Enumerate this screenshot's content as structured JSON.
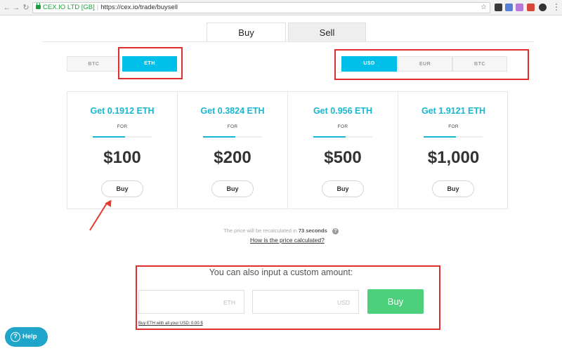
{
  "browser": {
    "secure_label": "CEX.IO LTD [GB]",
    "url": "https://cex.io/trade/buysell"
  },
  "icons": {
    "back": "arrow-left-icon",
    "forward": "arrow-right-icon",
    "reload": "reload-icon",
    "lock": "lock-icon",
    "bookmark": "star-icon",
    "menu": "more-vert-icon",
    "help": "question-circle-icon",
    "info": "question-circle-icon"
  },
  "browser_glyphs": {
    "back": "←",
    "forward": "→",
    "reload": "↻",
    "star": "☆",
    "menu": "⋮"
  },
  "tabs": [
    {
      "label": "Buy",
      "active": true
    },
    {
      "label": "Sell",
      "active": false
    }
  ],
  "crypto_toggle": [
    {
      "label": "BTC",
      "active": false
    },
    {
      "label": "ETH",
      "active": true
    }
  ],
  "currency_toggle": [
    {
      "label": "USD",
      "active": true
    },
    {
      "label": "EUR",
      "active": false
    },
    {
      "label": "BTC",
      "active": false
    }
  ],
  "cards": [
    {
      "title": "Get 0.1912 ETH",
      "for": "FOR",
      "price": "$100",
      "button": "Buy"
    },
    {
      "title": "Get 0.3824 ETH",
      "for": "FOR",
      "price": "$200",
      "button": "Buy"
    },
    {
      "title": "Get 0.956 ETH",
      "for": "FOR",
      "price": "$500",
      "button": "Buy"
    },
    {
      "title": "Get 1.9121 ETH",
      "for": "FOR",
      "price": "$1,000",
      "button": "Buy"
    }
  ],
  "recalc": {
    "prefix": "The price will be recalculated in",
    "seconds": "73 seconds",
    "link": "How is the price calculated?"
  },
  "custom": {
    "title": "You can also input a custom amount:",
    "eth_placeholder": "ETH",
    "usd_placeholder": "USD",
    "buy_button": "Buy",
    "buy_all_link": "Buy ETH with all your USD: 0.00 $"
  },
  "help": {
    "label": "Help"
  },
  "colors": {
    "accent": "#00c0ea",
    "title_accent": "#19b7cf",
    "buy_green": "#4cd07b",
    "highlight_red": "#e0302e",
    "help_blue": "#1fa5c9"
  }
}
